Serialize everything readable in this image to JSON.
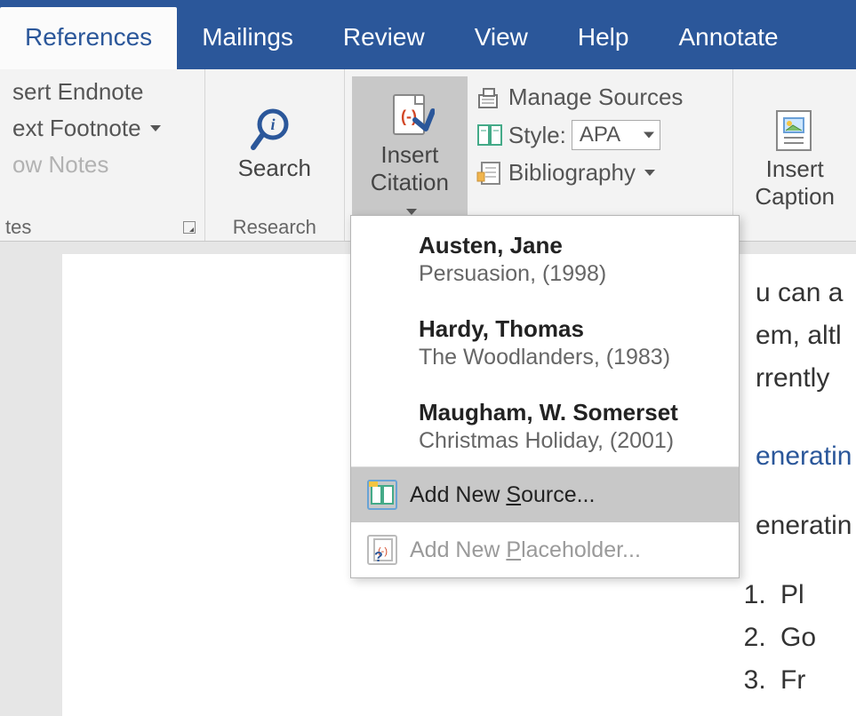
{
  "tabs": [
    {
      "label": "References",
      "active": true
    },
    {
      "label": "Mailings"
    },
    {
      "label": "Review"
    },
    {
      "label": "View"
    },
    {
      "label": "Help"
    },
    {
      "label": "Annotate"
    }
  ],
  "footnotes": {
    "insert_endnote": "sert Endnote",
    "next_footnote": "ext Footnote",
    "show_notes": "ow Notes",
    "group_label": "tes"
  },
  "research": {
    "search": "Search",
    "group_label": "Research"
  },
  "citations": {
    "insert_citation": "Insert Citation",
    "manage_sources": "Manage Sources",
    "style_label": "Style:",
    "style_value": "APA",
    "bibliography": "Bibliography"
  },
  "captions": {
    "insert_caption": "Insert Caption"
  },
  "dropdown": {
    "items": [
      {
        "author": "Austen, Jane",
        "title": "Persuasion, (1998)"
      },
      {
        "author": "Hardy, Thomas",
        "title": "The Woodlanders, (1983)"
      },
      {
        "author": "Maugham, W. Somerset",
        "title": "Christmas Holiday, (2001)"
      }
    ],
    "add_new_source": "Add New Source...",
    "add_new_placeholder": "Add New Placeholder..."
  },
  "doc": {
    "line1": "u can a",
    "line2": "em, altl",
    "line3": "rrently",
    "link1": "eneratin",
    "line4": "eneratin",
    "list": [
      "Pl",
      "Go",
      "Fr"
    ]
  }
}
